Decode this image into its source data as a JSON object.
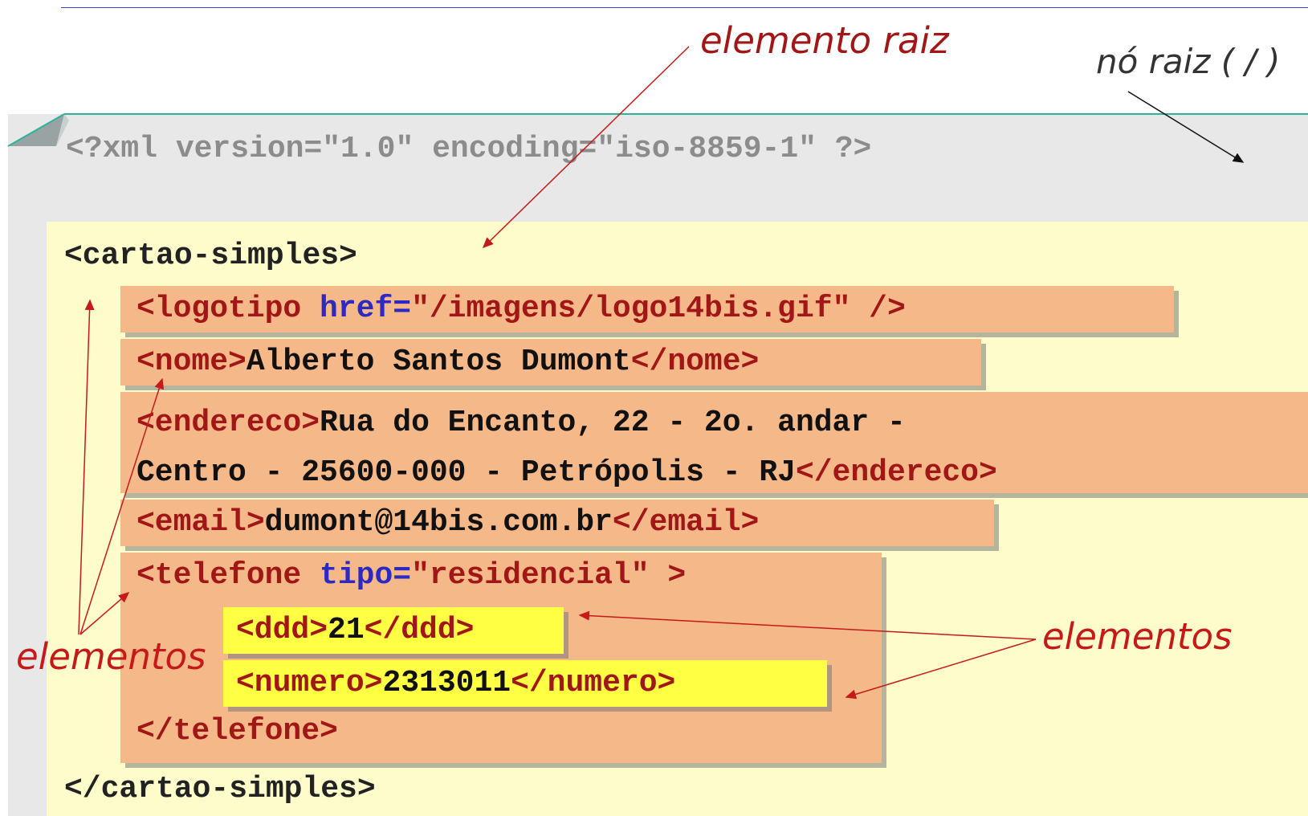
{
  "labels": {
    "root_element": "elemento raiz",
    "root_node": "nó raiz ( / )",
    "elements_left": "elementos",
    "elements_right": "elementos"
  },
  "code": {
    "prolog": "<?xml version=\"1.0\" encoding=\"iso-8859-1\" ?>",
    "open_cartao": "<cartao-simples>",
    "logotipo": {
      "tag_open": "<logotipo ",
      "attr": "href=",
      "value": "\"/imagens/logo14bis.gif\"",
      "tag_close": " />"
    },
    "nome": {
      "open": "<nome>",
      "text": "Alberto Santos Dumont",
      "close": "</nome>"
    },
    "endereco": {
      "open": "<endereco>",
      "text_line1": "Rua do Encanto, 22 - 2o. andar -",
      "text_line2": "Centro - 25600-000 - Petrópolis - RJ",
      "close": "</endereco>"
    },
    "email": {
      "open": "<email>",
      "text": "dumont@14bis.com.br",
      "close": "</email>"
    },
    "telefone_open": {
      "tag_open": "<telefone ",
      "attr": "tipo=",
      "value": "\"residencial\"",
      "tag_close": " >"
    },
    "ddd": {
      "open": "<ddd>",
      "text": "21",
      "close": "</ddd>"
    },
    "numero": {
      "open": "<numero>",
      "text": "2313011",
      "close": "</numero>"
    },
    "telefone_close": "</telefone>",
    "close_cartao": "</cartao-simples>"
  },
  "colors": {
    "document_bg": "#e8e8e8",
    "root_bg": "#fffccc",
    "element_bg": "#f5b889",
    "child_bg": "#ffff44",
    "tag": "#a11616",
    "attr": "#2d2ac4",
    "arrow_red": "#c41a1a",
    "frame_line": "#2db39a"
  }
}
